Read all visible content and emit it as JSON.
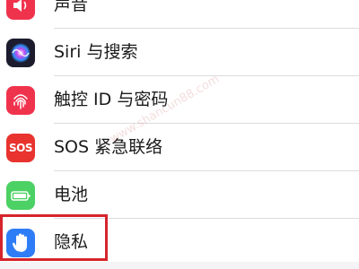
{
  "settings": {
    "items": [
      {
        "label": "声音",
        "icon": "speaker-icon",
        "color": "#f0334d"
      },
      {
        "label": "Siri 与搜索",
        "icon": "siri-icon",
        "color": "#1c1c2e"
      },
      {
        "label": "触控 ID 与密码",
        "icon": "fingerprint-icon",
        "color": "#f0334d"
      },
      {
        "label": "SOS 紧急联络",
        "icon": "sos-icon",
        "color": "#e8332e",
        "icon_text": "SOS"
      },
      {
        "label": "电池",
        "icon": "battery-icon",
        "color": "#4cd164"
      },
      {
        "label": "隐私",
        "icon": "hand-icon",
        "color": "#2f7df6"
      }
    ]
  },
  "highlight": {
    "color": "#d5242b"
  },
  "watermark": {
    "text": "www.shancun88.com"
  }
}
